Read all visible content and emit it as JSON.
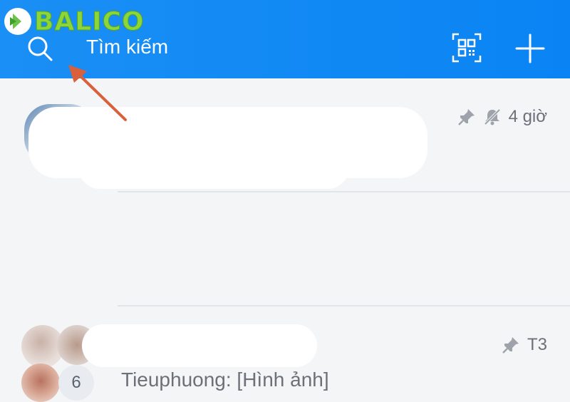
{
  "header": {
    "logo_text": "BALICO",
    "search_placeholder": "Tìm kiếm",
    "icons": {
      "search": "search-icon",
      "qr": "qr-code-icon",
      "add": "plus-icon"
    },
    "background_color": "#0a84f4"
  },
  "conversations": [
    {
      "time": "4 giờ",
      "pinned": true,
      "muted": true
    },
    {
      "time": "T3",
      "pinned": true,
      "member_count": "6",
      "preview": "Tieuphuong: [Hình ảnh]"
    }
  ],
  "annotation": {
    "arrow_color": "#d9603b"
  }
}
